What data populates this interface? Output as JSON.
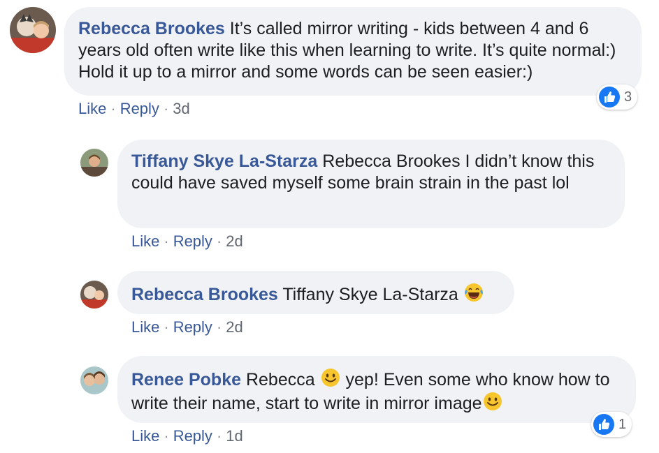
{
  "comments": [
    {
      "author": "Rebecca Brookes",
      "text": " It’s called mirror writing - kids between 4 and 6 years old often write like this when learning to write. It’s quite normal:) Hold it up to a mirror and some words can be seen easier:)",
      "like_label": "Like",
      "reply_label": "Reply",
      "time": "3d",
      "reaction_count": "3"
    },
    {
      "author": "Tiffany Skye La-Starza",
      "mention": " Rebecca Brookes",
      "text": " I didn’t know this could have saved myself some brain strain in the past lol",
      "like_label": "Like",
      "reply_label": "Reply",
      "time": "2d"
    },
    {
      "author": "Rebecca Brookes",
      "text": " Tiffany Skye La-Starza ",
      "emoji": "laughing-tears-emoji",
      "like_label": "Like",
      "reply_label": "Reply",
      "time": "2d"
    },
    {
      "author": "Renee Pobke",
      "text_a": " Rebecca ",
      "emoji_a": "smile-emoji",
      "text_b": " yep! Even some who know how to write their name, start to write in mirror image",
      "emoji_b": "smile-emoji",
      "like_label": "Like",
      "reply_label": "Reply",
      "time": "1d",
      "reaction_count": "1"
    }
  ],
  "separator": "·",
  "colors": {
    "author": "#385898",
    "bubble": "#f0f2f5",
    "like_blue": "#1877f2"
  }
}
